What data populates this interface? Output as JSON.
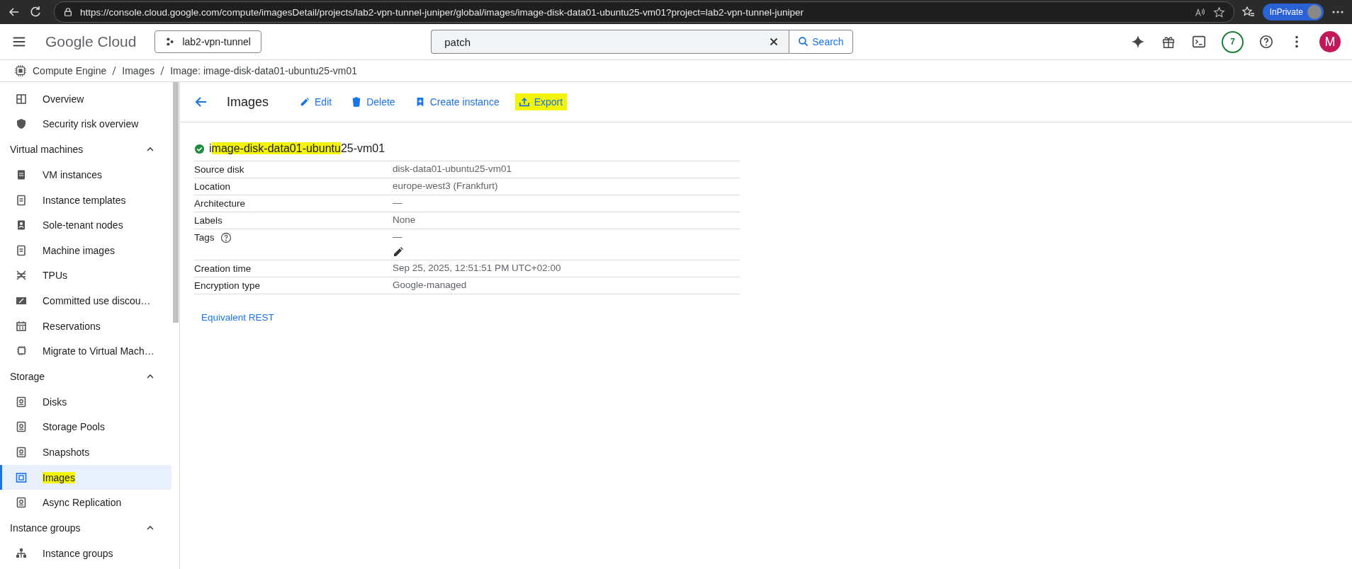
{
  "browser": {
    "url": "https://console.cloud.google.com/compute/imagesDetail/projects/lab2-vpn-tunnel-juniper/global/images/image-disk-data01-ubuntu25-vm01?project=lab2-vpn-tunnel-juniper",
    "profile": "InPrivate"
  },
  "header": {
    "product": "Google Cloud",
    "project": "lab2-vpn-tunnel",
    "search_value": "patch",
    "search_button": "Search",
    "notifications": "7",
    "avatar": "M"
  },
  "breadcrumb": [
    "Compute Engine",
    "Images",
    "Image: image-disk-data01-ubuntu25-vm01"
  ],
  "sidebar": [
    {
      "kind": "item",
      "label": "Overview",
      "selected": false,
      "highlighted": false
    },
    {
      "kind": "item",
      "label": "Security risk overview",
      "selected": false,
      "highlighted": false
    },
    {
      "kind": "section",
      "label": "Virtual machines",
      "expanded": true
    },
    {
      "kind": "item",
      "label": "VM instances",
      "selected": false,
      "highlighted": false
    },
    {
      "kind": "item",
      "label": "Instance templates",
      "selected": false,
      "highlighted": false
    },
    {
      "kind": "item",
      "label": "Sole-tenant nodes",
      "selected": false,
      "highlighted": false
    },
    {
      "kind": "item",
      "label": "Machine images",
      "selected": false,
      "highlighted": false
    },
    {
      "kind": "item",
      "label": "TPUs",
      "selected": false,
      "highlighted": false
    },
    {
      "kind": "item",
      "label": "Committed use discou…",
      "selected": false,
      "highlighted": false
    },
    {
      "kind": "item",
      "label": "Reservations",
      "selected": false,
      "highlighted": false
    },
    {
      "kind": "item",
      "label": "Migrate to Virtual Mach…",
      "selected": false,
      "highlighted": false
    },
    {
      "kind": "section",
      "label": "Storage",
      "expanded": true
    },
    {
      "kind": "item",
      "label": "Disks",
      "selected": false,
      "highlighted": false
    },
    {
      "kind": "item",
      "label": "Storage Pools",
      "selected": false,
      "highlighted": false
    },
    {
      "kind": "item",
      "label": "Snapshots",
      "selected": false,
      "highlighted": false
    },
    {
      "kind": "item",
      "label": "Images",
      "selected": true,
      "highlighted": true
    },
    {
      "kind": "item",
      "label": "Async Replication",
      "selected": false,
      "highlighted": false
    },
    {
      "kind": "section",
      "label": "Instance groups",
      "expanded": true
    },
    {
      "kind": "item",
      "label": "Instance groups",
      "selected": false,
      "highlighted": false
    }
  ],
  "toolbar": {
    "title": "Images",
    "actions": [
      {
        "label": "Edit",
        "highlighted": false
      },
      {
        "label": "Delete",
        "highlighted": false
      },
      {
        "label": "Create instance",
        "highlighted": false
      },
      {
        "label": "Export",
        "highlighted": true
      }
    ]
  },
  "image": {
    "title_segments": [
      {
        "text": "i",
        "highlighted": false
      },
      {
        "text": "mage-disk-data01-ubuntu",
        "highlighted": true
      },
      {
        "text": "25-vm01",
        "highlighted": false
      }
    ],
    "properties": [
      {
        "label": "Source disk",
        "value": "disk-data01-ubuntu25-vm01",
        "help": false,
        "editable": false
      },
      {
        "label": "Location",
        "value": "europe-west3 (Frankfurt)",
        "help": false,
        "editable": false
      },
      {
        "label": "Architecture",
        "value": "—",
        "help": false,
        "editable": false
      },
      {
        "label": "Labels",
        "value": "None",
        "help": false,
        "editable": false
      },
      {
        "label": "Tags",
        "value": "—",
        "help": true,
        "editable": true
      },
      {
        "label": "Creation time",
        "value": "Sep 25, 2025, 12:51:51 PM UTC+02:00",
        "help": false,
        "editable": false
      },
      {
        "label": "Encryption type",
        "value": "Google-managed",
        "help": false,
        "editable": false
      }
    ]
  },
  "rest_link": "Equivalent REST"
}
